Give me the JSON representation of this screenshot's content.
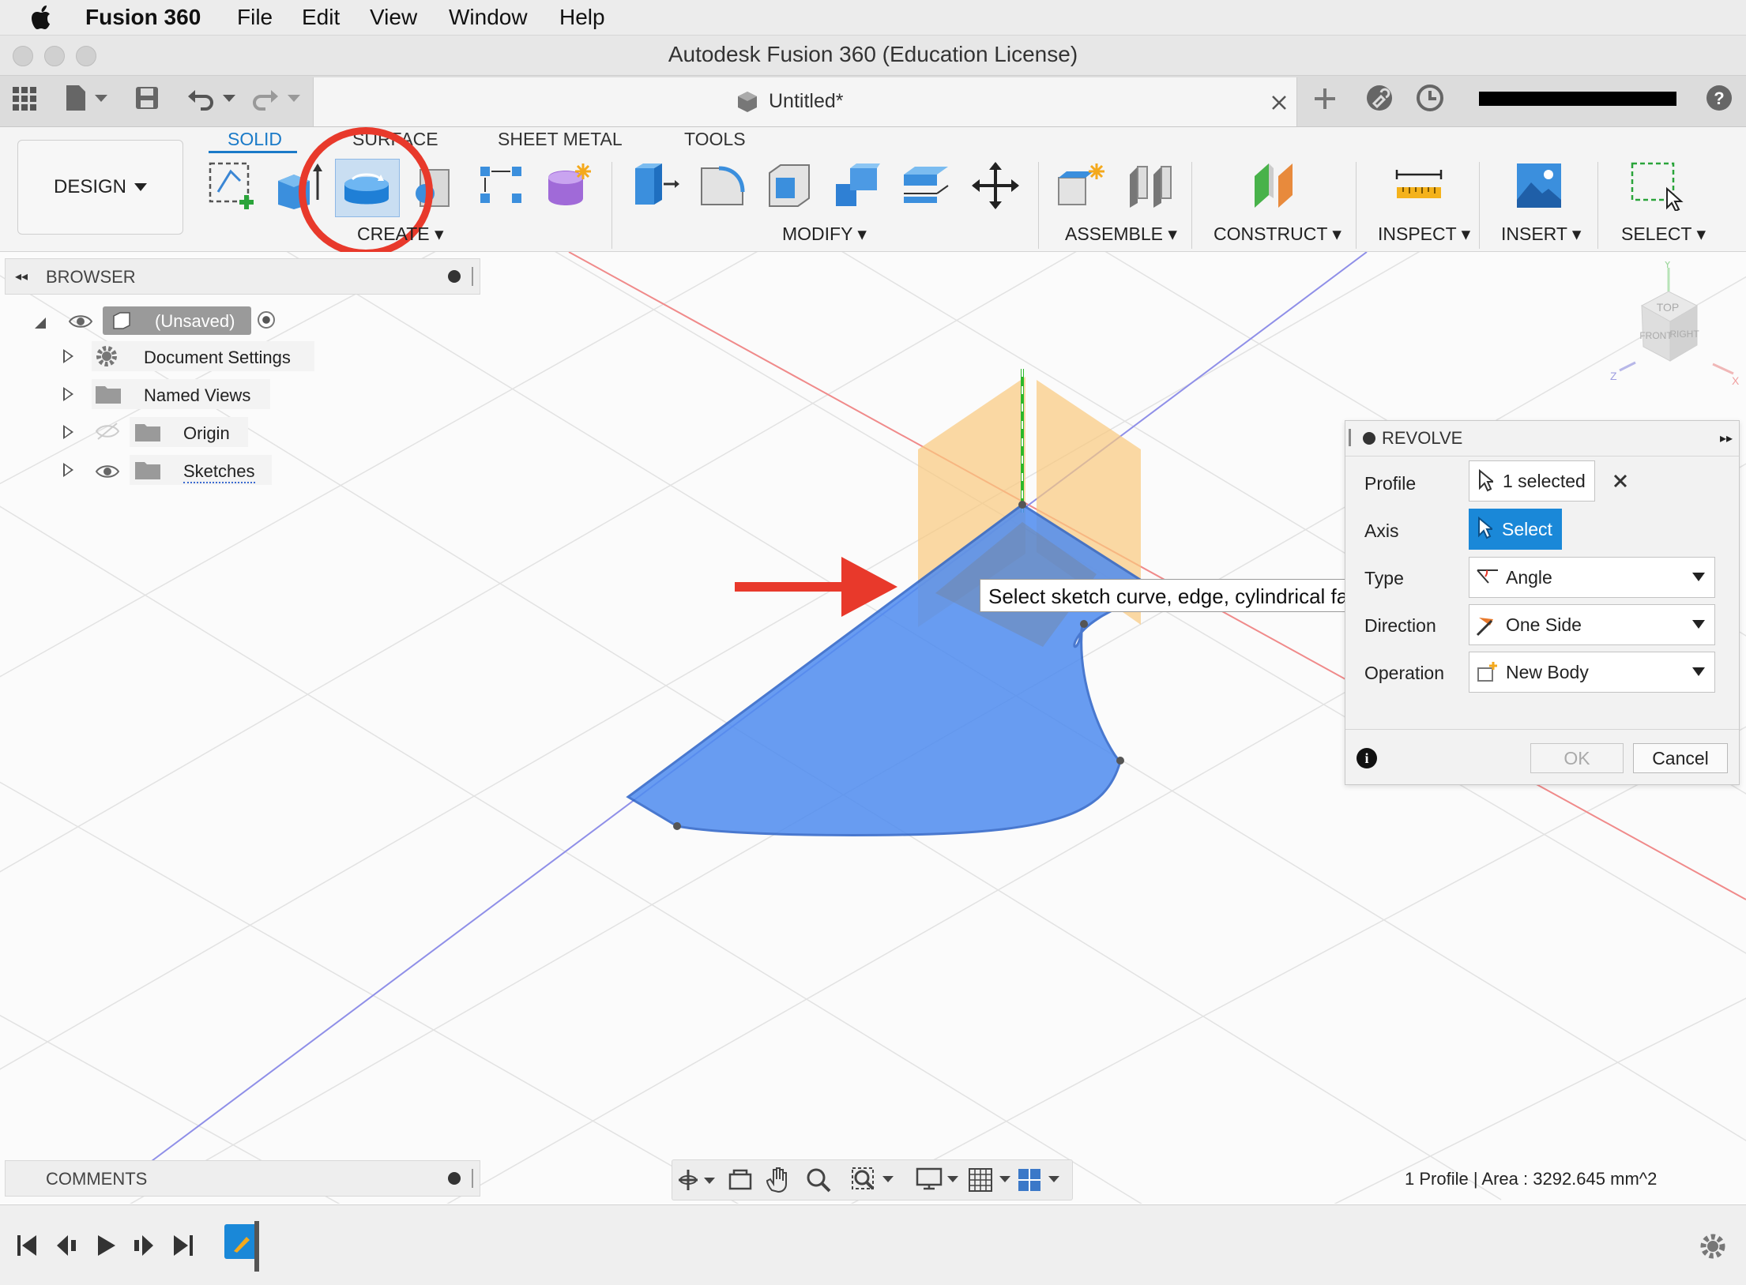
{
  "menubar": {
    "app_name": "Fusion 360",
    "items": [
      "File",
      "Edit",
      "View",
      "Window",
      "Help"
    ]
  },
  "window": {
    "title": "Autodesk Fusion 360 (Education License)"
  },
  "document_tab": {
    "name": "Untitled*"
  },
  "toolbar": {
    "workspace": "DESIGN",
    "tabs": [
      "SOLID",
      "SURFACE",
      "SHEET METAL",
      "TOOLS"
    ],
    "active_tab": "SOLID",
    "groups": {
      "create": "CREATE",
      "modify": "MODIFY",
      "assemble": "ASSEMBLE",
      "construct": "CONSTRUCT",
      "inspect": "INSPECT",
      "insert": "INSERT",
      "select": "SELECT"
    }
  },
  "browser": {
    "title": "BROWSER",
    "root": "(Unsaved)",
    "items": [
      "Document Settings",
      "Named Views",
      "Origin",
      "Sketches"
    ]
  },
  "comments": {
    "title": "COMMENTS"
  },
  "revolve_panel": {
    "title": "REVOLVE",
    "profile_label": "Profile",
    "profile_value": "1 selected",
    "axis_label": "Axis",
    "axis_button": "Select",
    "type_label": "Type",
    "type_value": "Angle",
    "direction_label": "Direction",
    "direction_value": "One Side",
    "operation_label": "Operation",
    "operation_value": "New Body",
    "ok_label": "OK",
    "cancel_label": "Cancel"
  },
  "tooltip": {
    "text": "Select sketch curve, edge, cylindrical face or axis"
  },
  "viewcube": {
    "faces": [
      "TOP",
      "FRONT",
      "RIGHT"
    ],
    "axes": [
      "Y",
      "Z",
      "X"
    ]
  },
  "status": {
    "text": "1 Profile | Area : 3292.645 mm^2"
  },
  "colors": {
    "accent": "#1a88d8",
    "profile_fill": "#4f8cf0",
    "annotation_red": "#e8392b",
    "plane_orange": "#f9c97e"
  }
}
